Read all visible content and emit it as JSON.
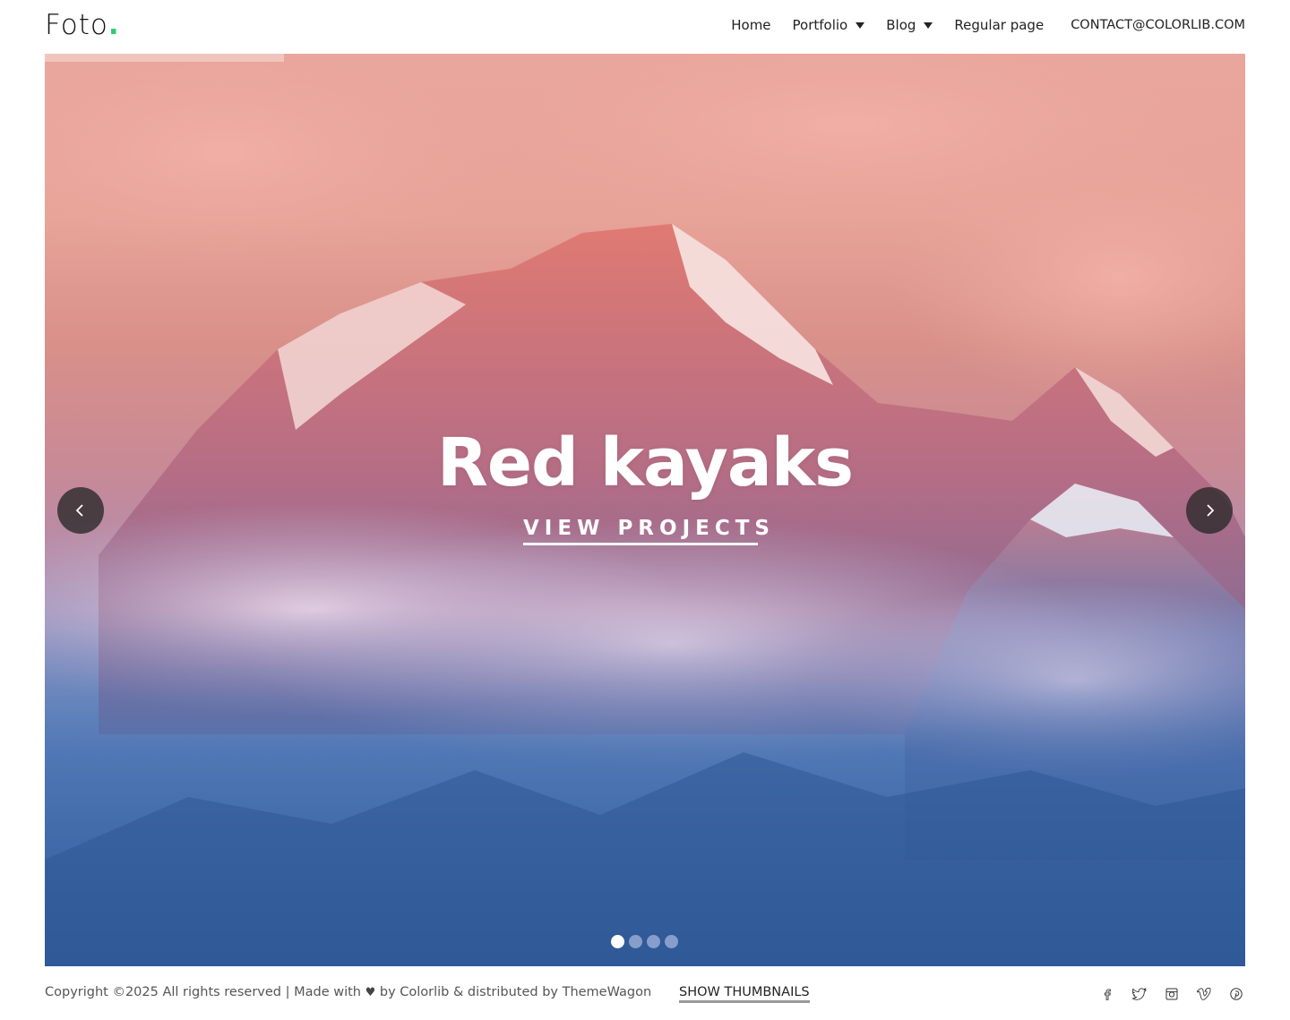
{
  "brand": {
    "name": "Foto",
    "dot": ".",
    "accent_color": "#2ecc71"
  },
  "nav": {
    "items": [
      {
        "label": "Home",
        "has_dropdown": false
      },
      {
        "label": "Portfolio",
        "has_dropdown": true
      },
      {
        "label": "Blog",
        "has_dropdown": true
      },
      {
        "label": "Regular page",
        "has_dropdown": false
      }
    ],
    "contact": "CONTACT@COLORLIB.COM"
  },
  "hero": {
    "title": "Red kayaks",
    "cta_label": "VIEW PROJECTS",
    "prev_icon": "chevron-left-icon",
    "next_icon": "chevron-right-icon",
    "slide_count": 4,
    "active_slide": 1
  },
  "footer": {
    "copyright_before": "Copyright ©2025 All rights reserved | Made with ",
    "copyright_after": " by Colorlib & distributed by ThemeWagon",
    "heart_icon": "heart-icon",
    "show_thumbnails": "SHOW THUMBNAILS",
    "socials": [
      "facebook-icon",
      "twitter-icon",
      "instagram-icon",
      "vimeo-icon",
      "pinterest-icon"
    ]
  }
}
